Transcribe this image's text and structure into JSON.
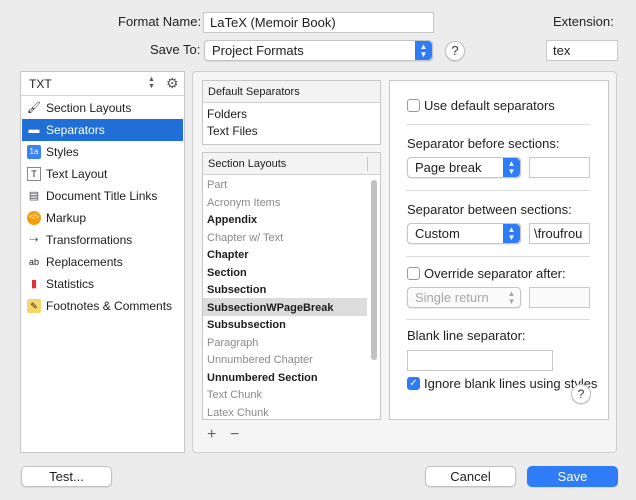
{
  "header": {
    "format_name_label": "Format Name:",
    "format_name_value": "LaTeX (Memoir Book)",
    "save_to_label": "Save To:",
    "save_to_value": "Project Formats",
    "extension_label": "Extension:",
    "extension_value": "tex",
    "help": "?"
  },
  "sidebar": {
    "type_value": "TXT",
    "gear_icon": "⚙",
    "items": [
      {
        "label": "Section Layouts",
        "icon": "🖌"
      },
      {
        "label": "Separators",
        "icon": "▬"
      },
      {
        "label": "Styles",
        "icon": "1a"
      },
      {
        "label": "Text Layout",
        "icon": "T"
      },
      {
        "label": "Document Title Links",
        "icon": "▤"
      },
      {
        "label": "Markup",
        "icon": "</>"
      },
      {
        "label": "Transformations",
        "icon": "⇢"
      },
      {
        "label": "Replacements",
        "icon": "ab"
      },
      {
        "label": "Statistics",
        "icon": "▮"
      },
      {
        "label": "Footnotes & Comments",
        "icon": "✎"
      }
    ],
    "selected_index": 1
  },
  "separators_list": {
    "header": "Default Separators",
    "items": [
      "Folders",
      "Text Files"
    ]
  },
  "section_layouts": {
    "header": "Section Layouts",
    "items": [
      {
        "label": "Part",
        "style": "gray"
      },
      {
        "label": "Acronym Items",
        "style": "gray"
      },
      {
        "label": "Appendix",
        "style": "bold"
      },
      {
        "label": "Chapter w/ Text",
        "style": "gray"
      },
      {
        "label": "Chapter",
        "style": "bold"
      },
      {
        "label": "Section",
        "style": "bold"
      },
      {
        "label": "Subsection",
        "style": "bold"
      },
      {
        "label": "SubsectionWPageBreak",
        "style": "bold"
      },
      {
        "label": "Subsubsection",
        "style": "bold"
      },
      {
        "label": "Paragraph",
        "style": "gray"
      },
      {
        "label": "Unnumbered Chapter",
        "style": "gray"
      },
      {
        "label": "Unnumbered Section",
        "style": "bold"
      },
      {
        "label": "Text Chunk",
        "style": "gray"
      },
      {
        "label": "Latex Chunk",
        "style": "gray"
      }
    ],
    "selected_index": 7,
    "add_icon": "+",
    "remove_icon": "−"
  },
  "settings": {
    "use_default_label": "Use default separators",
    "use_default_checked": false,
    "before_label": "Separator before sections:",
    "before_value": "Page break",
    "before_custom": "",
    "between_label": "Separator between sections:",
    "between_value": "Custom",
    "between_custom": "\\froufrou",
    "override_label": "Override separator after:",
    "override_checked": false,
    "override_value": "Single return",
    "override_custom": "",
    "blank_line_label": "Blank line separator:",
    "blank_line_value": "",
    "ignore_blank_label": "Ignore blank lines using styles",
    "ignore_blank_checked": true,
    "help": "?"
  },
  "footer": {
    "test_label": "Test...",
    "cancel_label": "Cancel",
    "save_label": "Save"
  },
  "colors": {
    "accent": "#2f7df6",
    "selection": "#1f6fd6"
  }
}
